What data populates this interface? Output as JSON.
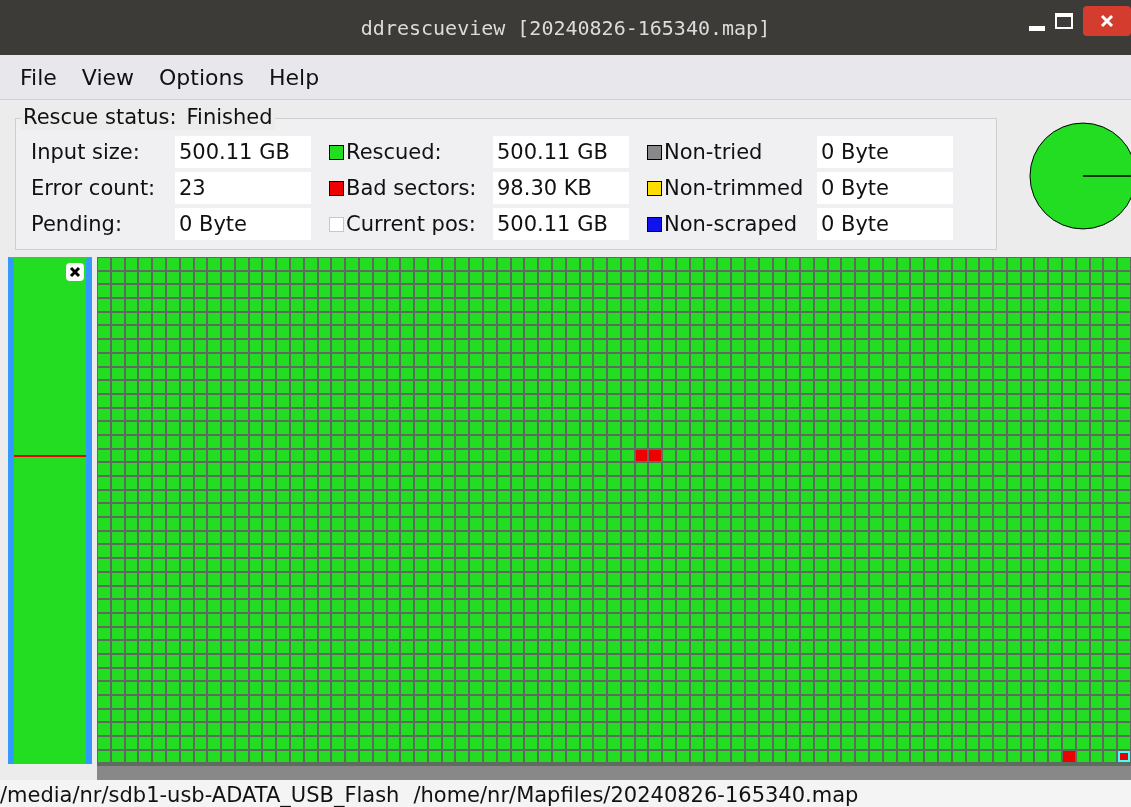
{
  "window": {
    "title": "ddrescueview [20240826-165340.map]"
  },
  "menu": [
    "File",
    "View",
    "Options",
    "Help"
  ],
  "rescue_status": {
    "label": "Rescue status:",
    "value": "Finished",
    "fields": [
      {
        "label": "Input size:",
        "value": "500.11 GB"
      },
      {
        "label": "Rescued:",
        "value": "500.11 GB",
        "color": "#22dd22",
        "kind": "filled"
      },
      {
        "label": "Non-tried",
        "value": "0 Byte",
        "color": "#888888",
        "kind": "filled"
      },
      {
        "label": "Error count:",
        "value": "23"
      },
      {
        "label": "Bad sectors:",
        "value": "98.30 KB",
        "color": "#ee0000",
        "kind": "filled"
      },
      {
        "label": "Non-trimmed",
        "value": "0 Byte",
        "color": "#ffdd00",
        "kind": "filled"
      },
      {
        "label": "Pending:",
        "value": "0 Byte"
      },
      {
        "label": "Current pos:",
        "value": "500.11 GB",
        "color": "#44ffff",
        "kind": "outline"
      },
      {
        "label": "Non-scraped",
        "value": "0 Byte",
        "color": "#1111ee",
        "kind": "filled"
      }
    ]
  },
  "status_bar": {
    "device": "/media/nr/sdb1-usb-ADATA_USB_Flash",
    "mapfile": "/home/nr/Mapfiles/20240826-165340.map"
  }
}
